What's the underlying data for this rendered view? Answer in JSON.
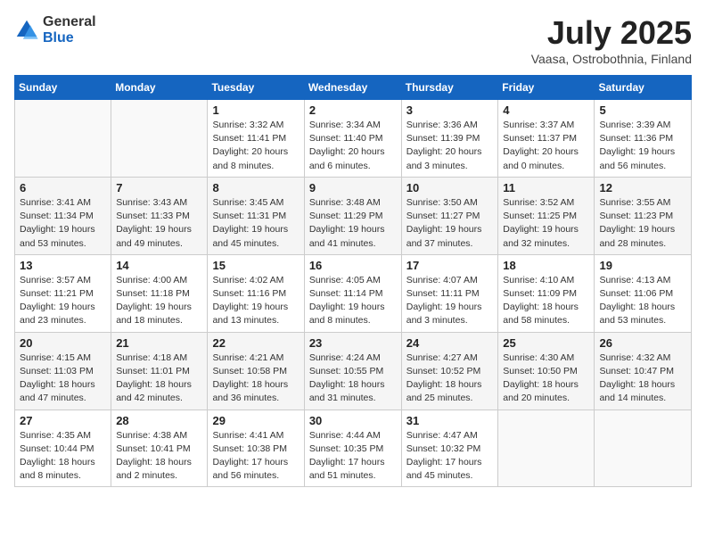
{
  "header": {
    "logo_general": "General",
    "logo_blue": "Blue",
    "month_title": "July 2025",
    "subtitle": "Vaasa, Ostrobothnia, Finland"
  },
  "days_of_week": [
    "Sunday",
    "Monday",
    "Tuesday",
    "Wednesday",
    "Thursday",
    "Friday",
    "Saturday"
  ],
  "weeks": [
    [
      {
        "day": "",
        "detail": ""
      },
      {
        "day": "",
        "detail": ""
      },
      {
        "day": "1",
        "detail": "Sunrise: 3:32 AM\nSunset: 11:41 PM\nDaylight: 20 hours\nand 8 minutes."
      },
      {
        "day": "2",
        "detail": "Sunrise: 3:34 AM\nSunset: 11:40 PM\nDaylight: 20 hours\nand 6 minutes."
      },
      {
        "day": "3",
        "detail": "Sunrise: 3:36 AM\nSunset: 11:39 PM\nDaylight: 20 hours\nand 3 minutes."
      },
      {
        "day": "4",
        "detail": "Sunrise: 3:37 AM\nSunset: 11:37 PM\nDaylight: 20 hours\nand 0 minutes."
      },
      {
        "day": "5",
        "detail": "Sunrise: 3:39 AM\nSunset: 11:36 PM\nDaylight: 19 hours\nand 56 minutes."
      }
    ],
    [
      {
        "day": "6",
        "detail": "Sunrise: 3:41 AM\nSunset: 11:34 PM\nDaylight: 19 hours\nand 53 minutes."
      },
      {
        "day": "7",
        "detail": "Sunrise: 3:43 AM\nSunset: 11:33 PM\nDaylight: 19 hours\nand 49 minutes."
      },
      {
        "day": "8",
        "detail": "Sunrise: 3:45 AM\nSunset: 11:31 PM\nDaylight: 19 hours\nand 45 minutes."
      },
      {
        "day": "9",
        "detail": "Sunrise: 3:48 AM\nSunset: 11:29 PM\nDaylight: 19 hours\nand 41 minutes."
      },
      {
        "day": "10",
        "detail": "Sunrise: 3:50 AM\nSunset: 11:27 PM\nDaylight: 19 hours\nand 37 minutes."
      },
      {
        "day": "11",
        "detail": "Sunrise: 3:52 AM\nSunset: 11:25 PM\nDaylight: 19 hours\nand 32 minutes."
      },
      {
        "day": "12",
        "detail": "Sunrise: 3:55 AM\nSunset: 11:23 PM\nDaylight: 19 hours\nand 28 minutes."
      }
    ],
    [
      {
        "day": "13",
        "detail": "Sunrise: 3:57 AM\nSunset: 11:21 PM\nDaylight: 19 hours\nand 23 minutes."
      },
      {
        "day": "14",
        "detail": "Sunrise: 4:00 AM\nSunset: 11:18 PM\nDaylight: 19 hours\nand 18 minutes."
      },
      {
        "day": "15",
        "detail": "Sunrise: 4:02 AM\nSunset: 11:16 PM\nDaylight: 19 hours\nand 13 minutes."
      },
      {
        "day": "16",
        "detail": "Sunrise: 4:05 AM\nSunset: 11:14 PM\nDaylight: 19 hours\nand 8 minutes."
      },
      {
        "day": "17",
        "detail": "Sunrise: 4:07 AM\nSunset: 11:11 PM\nDaylight: 19 hours\nand 3 minutes."
      },
      {
        "day": "18",
        "detail": "Sunrise: 4:10 AM\nSunset: 11:09 PM\nDaylight: 18 hours\nand 58 minutes."
      },
      {
        "day": "19",
        "detail": "Sunrise: 4:13 AM\nSunset: 11:06 PM\nDaylight: 18 hours\nand 53 minutes."
      }
    ],
    [
      {
        "day": "20",
        "detail": "Sunrise: 4:15 AM\nSunset: 11:03 PM\nDaylight: 18 hours\nand 47 minutes."
      },
      {
        "day": "21",
        "detail": "Sunrise: 4:18 AM\nSunset: 11:01 PM\nDaylight: 18 hours\nand 42 minutes."
      },
      {
        "day": "22",
        "detail": "Sunrise: 4:21 AM\nSunset: 10:58 PM\nDaylight: 18 hours\nand 36 minutes."
      },
      {
        "day": "23",
        "detail": "Sunrise: 4:24 AM\nSunset: 10:55 PM\nDaylight: 18 hours\nand 31 minutes."
      },
      {
        "day": "24",
        "detail": "Sunrise: 4:27 AM\nSunset: 10:52 PM\nDaylight: 18 hours\nand 25 minutes."
      },
      {
        "day": "25",
        "detail": "Sunrise: 4:30 AM\nSunset: 10:50 PM\nDaylight: 18 hours\nand 20 minutes."
      },
      {
        "day": "26",
        "detail": "Sunrise: 4:32 AM\nSunset: 10:47 PM\nDaylight: 18 hours\nand 14 minutes."
      }
    ],
    [
      {
        "day": "27",
        "detail": "Sunrise: 4:35 AM\nSunset: 10:44 PM\nDaylight: 18 hours\nand 8 minutes."
      },
      {
        "day": "28",
        "detail": "Sunrise: 4:38 AM\nSunset: 10:41 PM\nDaylight: 18 hours\nand 2 minutes."
      },
      {
        "day": "29",
        "detail": "Sunrise: 4:41 AM\nSunset: 10:38 PM\nDaylight: 17 hours\nand 56 minutes."
      },
      {
        "day": "30",
        "detail": "Sunrise: 4:44 AM\nSunset: 10:35 PM\nDaylight: 17 hours\nand 51 minutes."
      },
      {
        "day": "31",
        "detail": "Sunrise: 4:47 AM\nSunset: 10:32 PM\nDaylight: 17 hours\nand 45 minutes."
      },
      {
        "day": "",
        "detail": ""
      },
      {
        "day": "",
        "detail": ""
      }
    ]
  ]
}
